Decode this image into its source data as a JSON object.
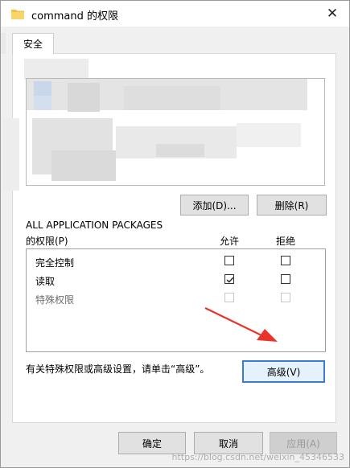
{
  "window": {
    "title": "command 的权限",
    "close_glyph": "✕"
  },
  "tabs": [
    {
      "label": "安全"
    }
  ],
  "groups": {
    "add_button": "添加(D)...",
    "remove_button": "删除(R)"
  },
  "permissions": {
    "group_name": "ALL APPLICATION PACKAGES",
    "header_label": "的权限(P)",
    "allow_header": "允许",
    "deny_header": "拒绝",
    "rows": [
      {
        "label": "完全控制",
        "allow": false,
        "deny": false,
        "enabled": true
      },
      {
        "label": "读取",
        "allow": true,
        "deny": false,
        "enabled": true
      },
      {
        "label": "特殊权限",
        "allow": false,
        "deny": false,
        "enabled": false
      }
    ]
  },
  "advanced": {
    "hint": "有关特殊权限或高级设置，请单击“高级”。",
    "button": "高级(V)"
  },
  "footer": {
    "ok": "确定",
    "cancel": "取消",
    "apply": "应用(A)"
  },
  "watermark": "https://blog.csdn.net/weixin_45346533",
  "colors": {
    "accent_border": "#3a7bd5",
    "arrow_red": "#e8342a"
  },
  "icons": {
    "title": "folder-icon",
    "close": "close-icon",
    "check": "checkmark-icon",
    "annotation": "red-arrow-icon"
  }
}
